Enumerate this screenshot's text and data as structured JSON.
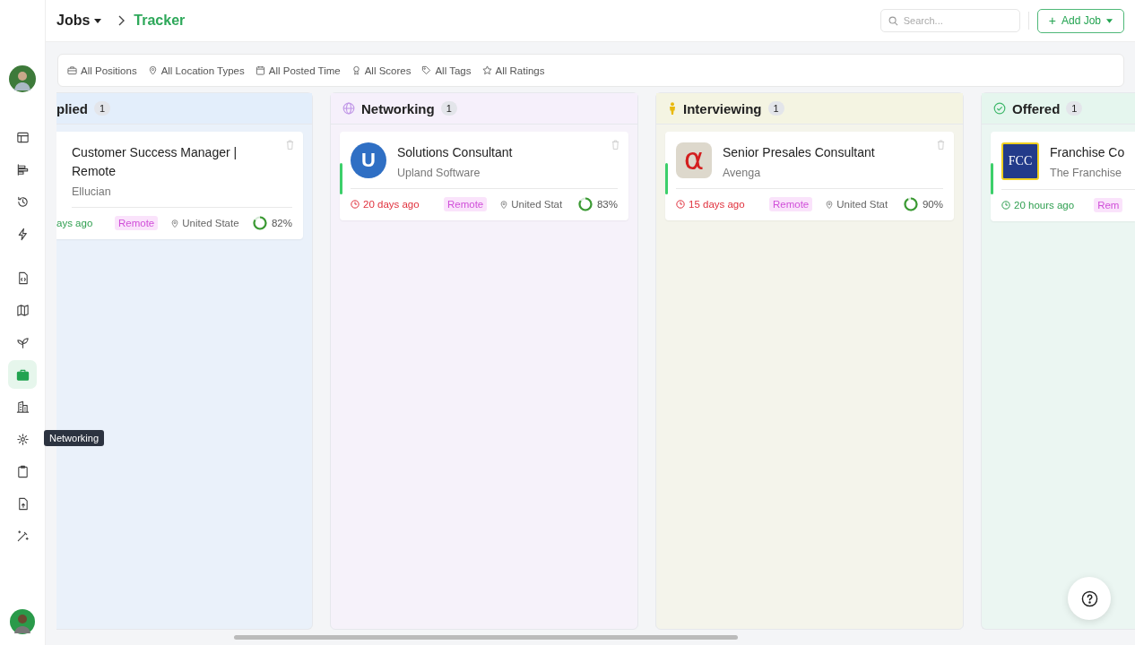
{
  "sidebar": {
    "items": [
      {
        "kind": "layout",
        "selected": false
      },
      {
        "kind": "bars",
        "selected": false
      },
      {
        "kind": "history",
        "selected": false
      },
      {
        "kind": "bolt",
        "selected": false
      },
      {
        "kind": "divider"
      },
      {
        "kind": "code-file",
        "selected": false
      },
      {
        "kind": "map",
        "selected": false
      },
      {
        "kind": "sprout",
        "selected": false
      },
      {
        "kind": "briefcase",
        "selected": true
      },
      {
        "kind": "building",
        "selected": false
      },
      {
        "kind": "sparkle",
        "selected": false,
        "tooltip": "Networking"
      },
      {
        "kind": "clipboard",
        "selected": false
      },
      {
        "kind": "upload-file",
        "selected": false
      },
      {
        "kind": "wand",
        "selected": false
      }
    ]
  },
  "breadcrumb": {
    "root": "Jobs",
    "current": "Tracker"
  },
  "search": {
    "placeholder": "Search..."
  },
  "add_button": {
    "icon": "+",
    "label": "Add Job"
  },
  "filters": [
    {
      "label": "All Positions"
    },
    {
      "label": "All Location Types"
    },
    {
      "label": "All Posted Time"
    },
    {
      "label": "All Scores"
    },
    {
      "label": "All Tags"
    },
    {
      "label": "All Ratings"
    }
  ],
  "columns": [
    {
      "title": "plied",
      "count": "1",
      "color": "#e3eefb",
      "cards": [
        {
          "title": "Customer Success Manager | Remote",
          "company": "Ellucian",
          "accent": false,
          "time": "ays ago",
          "color": "#2e9e4f",
          "tag": "Remote",
          "location": "United State",
          "level": 0.82,
          "score": "82%"
        }
      ]
    },
    {
      "title": "Networking",
      "count": "1",
      "color": "#f6f0fb",
      "cards": [
        {
          "title": "Solutions Consultant",
          "company": "Upland Software",
          "logo_text": "U",
          "accent": true,
          "time": "20 days ago",
          "color": "#e0313d",
          "tag": "Remote",
          "location": "United Stat",
          "level": 0.83,
          "score": "83%"
        }
      ]
    },
    {
      "title": "Interviewing",
      "count": "1",
      "color": "#f4f4e2",
      "cards": [
        {
          "title": "Senior Presales Consultant",
          "company": "Avenga",
          "logo_text": "α",
          "accent": true,
          "time": "15 days ago",
          "color": "#e0313d",
          "tag": "Remote",
          "location": "United Stat",
          "level": 0.9,
          "score": "90%"
        }
      ]
    },
    {
      "title": "Offered",
      "count": "1",
      "color": "#e5f6ee",
      "cards": [
        {
          "title": "Franchise Co",
          "company": "The Franchise",
          "logo_text": "FCC",
          "accent": true,
          "time": "20 hours ago",
          "color": "#2e9e4f",
          "tag": "Rem"
        }
      ]
    }
  ]
}
